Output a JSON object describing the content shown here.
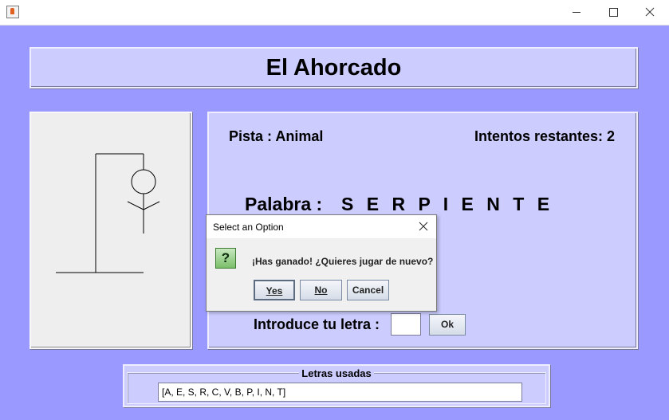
{
  "window": {
    "title": "",
    "controls": {
      "minimize_icon": "minimize-icon",
      "maximize_icon": "maximize-icon",
      "close_icon": "close-icon"
    }
  },
  "header": {
    "title": "El Ahorcado"
  },
  "game": {
    "hint": "Pista : Animal",
    "tries": "Intentos restantes: 2",
    "word_label": "Palabra :",
    "word_value": "S E R P I E N T E",
    "input_label": "Introduce tu letra :",
    "letter_input_value": "",
    "ok_label": "Ok"
  },
  "used_letters": {
    "title": "Letras usadas",
    "value": "[A, E, S, R, C, V, B, P, I, N, T]"
  },
  "dialog": {
    "title": "Select an Option",
    "icon": "question-icon",
    "icon_glyph": "?",
    "message": "¡Has ganado! ¿Quieres jugar de nuevo?",
    "buttons": {
      "yes": "Yes",
      "no": "No",
      "cancel": "Cancel"
    }
  },
  "colors": {
    "background": "#9999ff",
    "panel": "#ccccff",
    "drawing_area": "#eeeeee",
    "dialog": "#f0f0f0"
  }
}
